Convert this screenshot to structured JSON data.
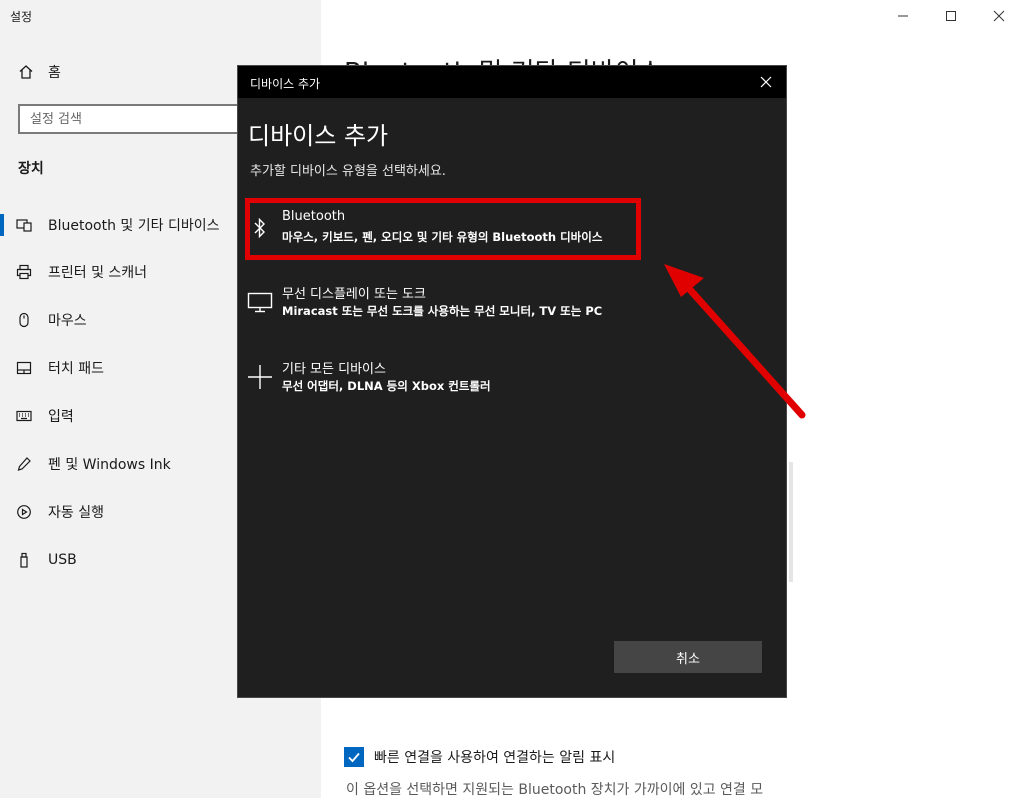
{
  "window": {
    "title": "설정"
  },
  "sidebar": {
    "home_label": "홈",
    "search_placeholder": "설정 검색",
    "section_title": "장치",
    "items": [
      {
        "label": "Bluetooth 및 기타 디바이스",
        "icon": "bluetooth-devices-icon",
        "active": true
      },
      {
        "label": "프린터 및 스캐너",
        "icon": "printer-icon"
      },
      {
        "label": "마우스",
        "icon": "mouse-icon"
      },
      {
        "label": "터치 패드",
        "icon": "touchpad-icon"
      },
      {
        "label": "입력",
        "icon": "keyboard-icon"
      },
      {
        "label": "펜 및 Windows Ink",
        "icon": "pen-icon"
      },
      {
        "label": "자동 실행",
        "icon": "autoplay-icon"
      },
      {
        "label": "USB",
        "icon": "usb-icon"
      }
    ]
  },
  "main": {
    "title": "Bluetooth 및 기타 디바이스",
    "swift_pair_label": "빠른 연결을 사용하여 연결하는 알림 표시",
    "swift_pair_checked": true,
    "swift_pair_desc": "이 옵션을 선택하면 지원되는 Bluetooth 장치가 가까이에 있고 연결 모"
  },
  "dialog": {
    "title": "디바이스 추가",
    "heading": "디바이스 추가",
    "subtitle": "추가할 디바이스 유형을 선택하세요.",
    "options": [
      {
        "name": "Bluetooth",
        "desc": "마우스, 키보드, 펜, 오디오 및 기타 유형의 Bluetooth 디바이스",
        "icon": "bluetooth-icon"
      },
      {
        "name": "무선 디스플레이 또는 도크",
        "desc": "Miracast 또는 무선 도크를 사용하는 무선 모니터, TV 또는 PC",
        "icon": "monitor-icon"
      },
      {
        "name": "기타 모든 디바이스",
        "desc": "무선 어댑터, DLNA 등의 Xbox 컨트롤러",
        "icon": "plus-icon"
      }
    ],
    "cancel_label": "취소"
  },
  "colors": {
    "accent": "#0067c0",
    "dialog_bg": "#1f1f1f",
    "highlight": "#e00000"
  }
}
